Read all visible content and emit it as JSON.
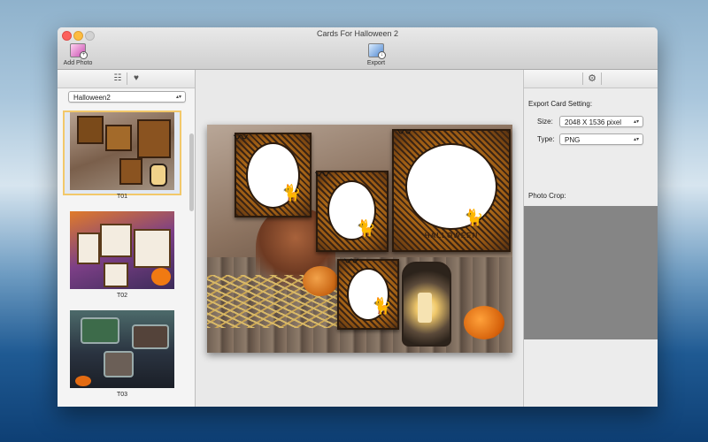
{
  "window": {
    "title": "Cards For Halloween 2"
  },
  "toolbar": {
    "add_photo_label": "Add Photo",
    "export_label": "Export"
  },
  "sidebar": {
    "tabs": [
      {
        "icon": "grid-icon"
      },
      {
        "icon": "heart-icon"
      }
    ],
    "theme_select": {
      "value": "Halloween2"
    },
    "templates": [
      {
        "label": "T01",
        "selected": true
      },
      {
        "label": "T02",
        "selected": false
      },
      {
        "label": "T03",
        "selected": false
      }
    ]
  },
  "card": {
    "halloween_text": "HALLOWEEN"
  },
  "settings": {
    "heading": "Export Card Setting:",
    "size_label": "Size:",
    "size_value": "2048 X 1536 pixel",
    "type_label": "Type:",
    "type_value": "PNG",
    "photo_crop_label": "Photo Crop:"
  },
  "colors": {
    "accent_selection": "#f2c86a",
    "crop_area": "#858585"
  }
}
